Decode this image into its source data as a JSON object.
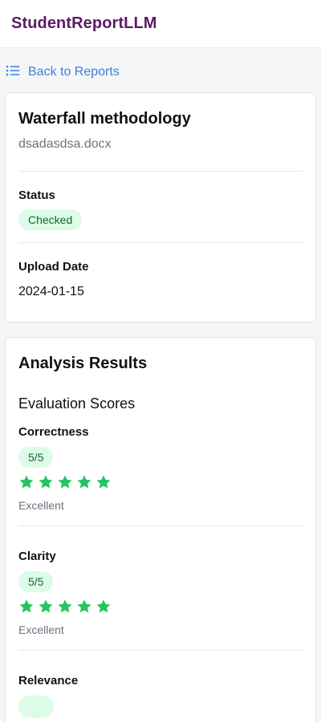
{
  "app": {
    "title": "StudentReportLLM"
  },
  "nav": {
    "back_label": "Back to Reports"
  },
  "report": {
    "title": "Waterfall methodology",
    "filename": "dsadasdsa.docx",
    "status_label": "Status",
    "status_value": "Checked",
    "upload_label": "Upload Date",
    "upload_value": "2024-01-15"
  },
  "analysis": {
    "title": "Analysis Results",
    "section_title": "Evaluation Scores",
    "metrics": [
      {
        "name": "Correctness",
        "score": "5/5",
        "stars": 5,
        "desc": "Excellent"
      },
      {
        "name": "Clarity",
        "score": "5/5",
        "stars": 5,
        "desc": "Excellent"
      },
      {
        "name": "Relevance"
      }
    ]
  },
  "colors": {
    "brand": "#5b1a66",
    "link": "#3b82d6",
    "pill_bg": "#dcfce7",
    "pill_text": "#166534",
    "star": "#22c55e"
  },
  "icons": {
    "back": "list-icon",
    "star": "star-icon"
  }
}
